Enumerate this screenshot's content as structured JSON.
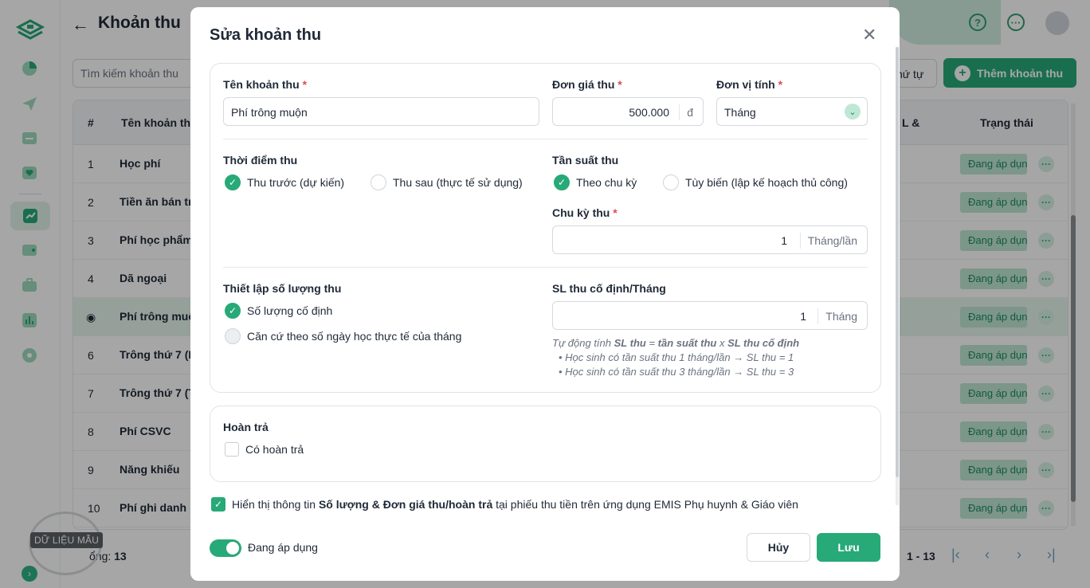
{
  "page": {
    "title": "Khoản thu",
    "search_placeholder": "Tìm kiếm khoản thu",
    "sort_label": "hứ tự",
    "add_label": "Thêm khoản thu",
    "watermark": "DỮ LIỆU MẪU",
    "total_label": "ổng:",
    "total_value": "13",
    "pager_range": "1 - 13"
  },
  "table": {
    "col_num": "#",
    "col_name": "Tên khoản th",
    "col_extra": "L &",
    "col_status": "Trạng thái",
    "rows": [
      {
        "num": "1",
        "name": "Học phí",
        "status": "Đang áp dụng"
      },
      {
        "num": "2",
        "name": "Tiền ăn bán tr",
        "status": "Đang áp dụng"
      },
      {
        "num": "3",
        "name": "Phí học phẩm",
        "status": "Đang áp dụng"
      },
      {
        "num": "4",
        "name": "Dã ngoại",
        "status": "Đang áp dụng"
      },
      {
        "num": "",
        "name": "Phí trông muộ",
        "status": "Đang áp dụng"
      },
      {
        "num": "6",
        "name": "Trông thứ 7 (I",
        "status": "Đang áp dụng"
      },
      {
        "num": "7",
        "name": "Trông thứ 7 (T",
        "status": "Đang áp dụng"
      },
      {
        "num": "8",
        "name": "Phí CSVC",
        "status": "Đang áp dụng"
      },
      {
        "num": "9",
        "name": "Năng khiếu",
        "status": "Đang áp dụng"
      },
      {
        "num": "10",
        "name": "Phí ghi danh",
        "status": "Đang áp dụng"
      }
    ]
  },
  "modal": {
    "title": "Sửa khoản thu",
    "name_label": "Tên khoản thu",
    "name_value": "Phí trông muộn",
    "price_label": "Đơn giá thu",
    "price_value": "500.000",
    "price_unit": "đ",
    "unit_label": "Đơn vị tính",
    "unit_value": "Tháng",
    "timing_label": "Thời điểm thu",
    "timing_opt1": "Thu trước (dự kiến)",
    "timing_opt2": "Thu sau (thực tế sử dụng)",
    "freq_label": "Tần suất thu",
    "freq_opt1": "Theo chu kỳ",
    "freq_opt2": "Tùy biến (lập kế hoạch thủ công)",
    "cycle_label": "Chu kỳ thu",
    "cycle_value": "1",
    "cycle_unit": "Tháng/lần",
    "qty_label": "Thiết lập số lượng thu",
    "qty_opt1": "Số lượng cố định",
    "qty_opt2": "Căn cứ theo số ngày học thực tế của tháng",
    "fixed_label": "SL thu cố định/Tháng",
    "fixed_value": "1",
    "fixed_unit": "Tháng",
    "hint_prefix": "Tự động tính ",
    "hint_b1": "SL thu",
    "hint_eq": " = ",
    "hint_b2": "tần suất thu",
    "hint_x": " x ",
    "hint_b3": "SL thu cố định",
    "hint_line2": "Học sinh có tần suất thu 1 tháng/lần → SL thu = 1",
    "hint_line3": "Học sinh có tần suất thu 3 tháng/lần → SL thu = 3",
    "refund_label": "Hoàn trả",
    "refund_check": "Có hoàn trả",
    "show_pre": "Hiển thị thông tin ",
    "show_bold": "Số lượng & Đơn giá thu/hoàn trả",
    "show_post": " tại phiếu thu tiền trên ứng dụng EMIS Phụ huynh & Giáo viên",
    "status_toggle": "Đang áp dụng",
    "cancel": "Hủy",
    "save": "Lưu"
  },
  "colors": {
    "accent": "#27a978",
    "required": "#e5484d"
  }
}
